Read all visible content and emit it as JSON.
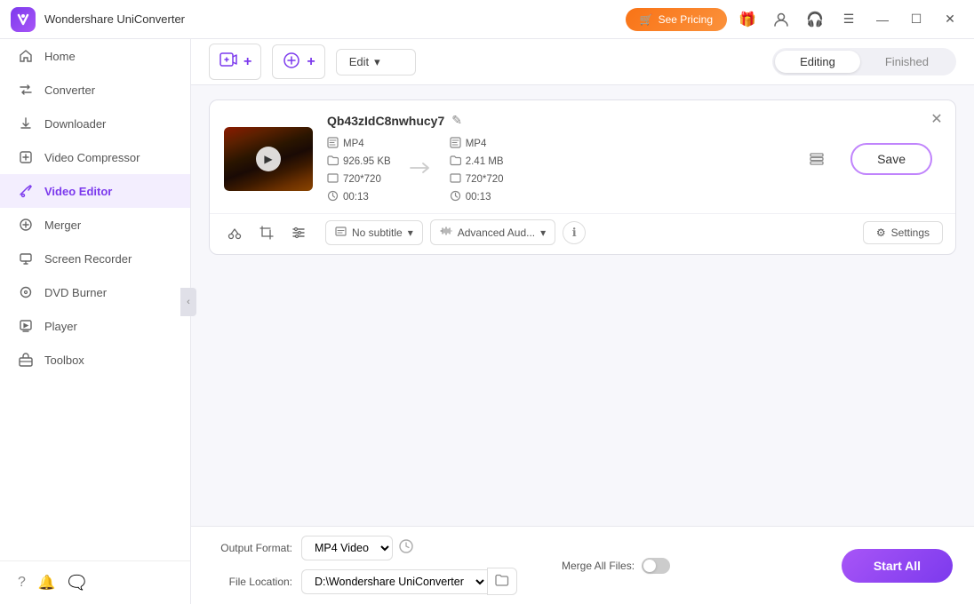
{
  "app": {
    "title": "Wondershare UniConverter",
    "logo_letter": "W"
  },
  "titlebar": {
    "see_pricing": "See Pricing",
    "gift_icon": "🎁",
    "profile_icon": "👤",
    "headset_icon": "🎧",
    "menu_icon": "☰",
    "minimize": "—",
    "maximize": "☐",
    "close": "✕"
  },
  "sidebar": {
    "items": [
      {
        "id": "home",
        "label": "Home",
        "icon": "⌂"
      },
      {
        "id": "converter",
        "label": "Converter",
        "icon": "⇄"
      },
      {
        "id": "downloader",
        "label": "Downloader",
        "icon": "⬇"
      },
      {
        "id": "video-compressor",
        "label": "Video Compressor",
        "icon": "⧉"
      },
      {
        "id": "video-editor",
        "label": "Video Editor",
        "icon": "✂",
        "active": true
      },
      {
        "id": "merger",
        "label": "Merger",
        "icon": "⊕"
      },
      {
        "id": "screen-recorder",
        "label": "Screen Recorder",
        "icon": "⊡"
      },
      {
        "id": "dvd-burner",
        "label": "DVD Burner",
        "icon": "💿"
      },
      {
        "id": "player",
        "label": "Player",
        "icon": "▶"
      },
      {
        "id": "toolbox",
        "label": "Toolbox",
        "icon": "⚙"
      }
    ],
    "bottom": {
      "help_icon": "?",
      "bell_icon": "🔔",
      "feedback_icon": "💬"
    }
  },
  "toolbar": {
    "add_video_label": "+",
    "add_icon_label": "+",
    "edit_label": "Edit",
    "tab_editing": "Editing",
    "tab_finished": "Finished"
  },
  "video_card": {
    "filename": "Qb43zIdC8nwhucy7",
    "edit_icon": "✎",
    "close_icon": "✕",
    "source": {
      "format": "MP4",
      "resolution": "720*720",
      "size": "926.95 KB",
      "duration": "00:13"
    },
    "output": {
      "format": "MP4",
      "resolution": "720*720",
      "size": "2.41 MB",
      "duration": "00:13"
    },
    "arrow": "→",
    "save_label": "Save",
    "tools": {
      "cut_icon": "✂",
      "crop_icon": "⊡",
      "adjust_icon": "☰",
      "subtitle_label": "No subtitle",
      "audio_label": "Advanced Aud...",
      "info_icon": "ℹ",
      "settings_label": "Settings",
      "settings_icon": "⚙"
    }
  },
  "bottom_bar": {
    "output_format_label": "Output Format:",
    "output_format_value": "MP4 Video",
    "file_location_label": "File Location:",
    "file_location_value": "D:\\Wondershare UniConverter",
    "merge_label": "Merge All Files:",
    "start_all_label": "Start All",
    "format_icon": "⊙",
    "folder_icon": "📁"
  }
}
